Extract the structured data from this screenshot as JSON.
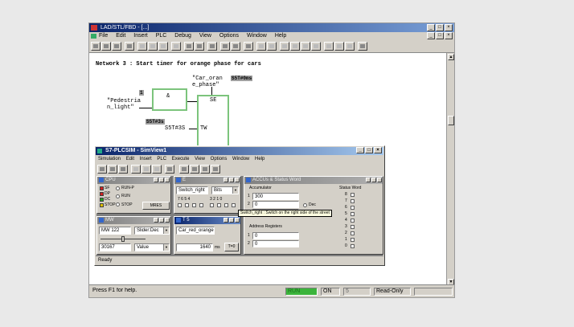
{
  "window": {
    "title": "LAD/STL/FBD - [...]"
  },
  "menu": {
    "items": [
      "File",
      "Edit",
      "Insert",
      "PLC",
      "Debug",
      "View",
      "Options",
      "Window",
      "Help"
    ]
  },
  "network": {
    "heading": "Network 3 : Start timer for orange phase for cars",
    "car_label_1": "\"Car_oran",
    "car_label_2": "e_phase\"",
    "car_addr": "S5T#0ms",
    "const_1": "1",
    "and_label": "&",
    "timer_label": "SE",
    "ped_label_1": "\"Pedestria",
    "ped_label_2": "n_light\"",
    "s5t_hl": "S5T#3s",
    "s5t_param": "S5T#3S",
    "tw_label": "TW"
  },
  "simview": {
    "title": "S7-PLCSIM - SimView1",
    "menu": [
      "Simulation",
      "Edit",
      "Insert",
      "PLC",
      "Execute",
      "View",
      "Options",
      "Window",
      "Help"
    ],
    "cpu": {
      "title": "CPU",
      "sf": "SF",
      "dp": "DP",
      "dc": "DC",
      "run_p": "RUN-P",
      "run": "RUN",
      "stop": "STOP",
      "run_label": "RUN",
      "stop_label": "STOP",
      "mres": "MRES"
    },
    "input_win": {
      "title": "E",
      "field": "Switch_right",
      "format": "Bits",
      "bits_left": "7 6 5 4",
      "bits_right": "3 2 1 0"
    },
    "accu_win": {
      "title": "ACCUs & Status Word",
      "accumulator_label": "Accumulator",
      "acc": [
        {
          "n": "1",
          "v": "300"
        },
        {
          "n": "2",
          "v": "0"
        },
        {
          "n": "3",
          "v": "0"
        }
      ],
      "dec_label": "Dec",
      "address_registers_label": "Address Registers",
      "ar": [
        {
          "n": "1",
          "v": "0"
        },
        {
          "n": "2",
          "v": "0"
        }
      ],
      "status_word_label": "Status Word",
      "sw_bits": [
        "8",
        "7",
        "6",
        "5",
        "4",
        "3",
        "2",
        "1",
        "0"
      ]
    },
    "mw_win": {
      "title": "MW",
      "addr": "MW 122",
      "format": "Slider:Dec",
      "value": "30167",
      "value_label": "Value"
    },
    "t_win": {
      "title": "T 5",
      "field": "Car_red_orange",
      "value": "1640",
      "unit": "ms",
      "btn": "T=0"
    },
    "tooltip": "Switch_right : Switch on the right side of the street",
    "status": "Ready"
  },
  "statusbar": {
    "help": "Press F1 for help.",
    "run": "RUN",
    "mid": "ON",
    "num": "5",
    "mode": "Read-Only"
  },
  "colors": {
    "green_box": "#7cc47c",
    "led_red": "#d02020",
    "led_green": "#20a020",
    "led_yellow": "#e0c000"
  }
}
